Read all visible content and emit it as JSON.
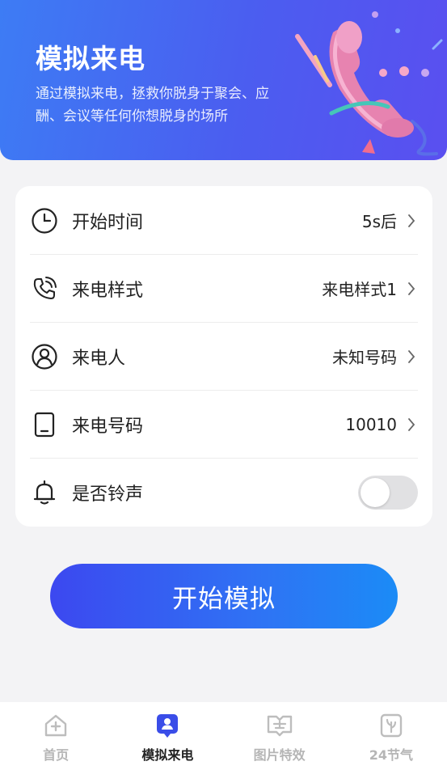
{
  "banner": {
    "title": "模拟来电",
    "description": "通过模拟来电，拯救你脱身于聚会、应酬、会议等任何你想脱身的场所"
  },
  "settings": {
    "rows": [
      {
        "label": "开始时间",
        "value": "5s后",
        "icon": "clock-icon"
      },
      {
        "label": "来电样式",
        "value": "来电样式1",
        "icon": "phone-call-icon"
      },
      {
        "label": "来电人",
        "value": "未知号码",
        "icon": "person-icon"
      },
      {
        "label": "来电号码",
        "value": "10010",
        "icon": "tablet-icon"
      }
    ],
    "ringtone": {
      "label": "是否铃声",
      "enabled": false,
      "icon": "bell-icon"
    }
  },
  "start_button": {
    "label": "开始模拟"
  },
  "tabbar": {
    "items": [
      {
        "label": "首页",
        "icon": "home-icon",
        "active": false
      },
      {
        "label": "模拟来电",
        "icon": "caller-icon",
        "active": true
      },
      {
        "label": "图片特效",
        "icon": "image-effect-icon",
        "active": false
      },
      {
        "label": "24节气",
        "icon": "solar-term-icon",
        "active": false
      }
    ]
  },
  "colors": {
    "accent": "#3c48f0",
    "banner_start": "#3d7cf4",
    "banner_end": "#5a4ff0"
  }
}
